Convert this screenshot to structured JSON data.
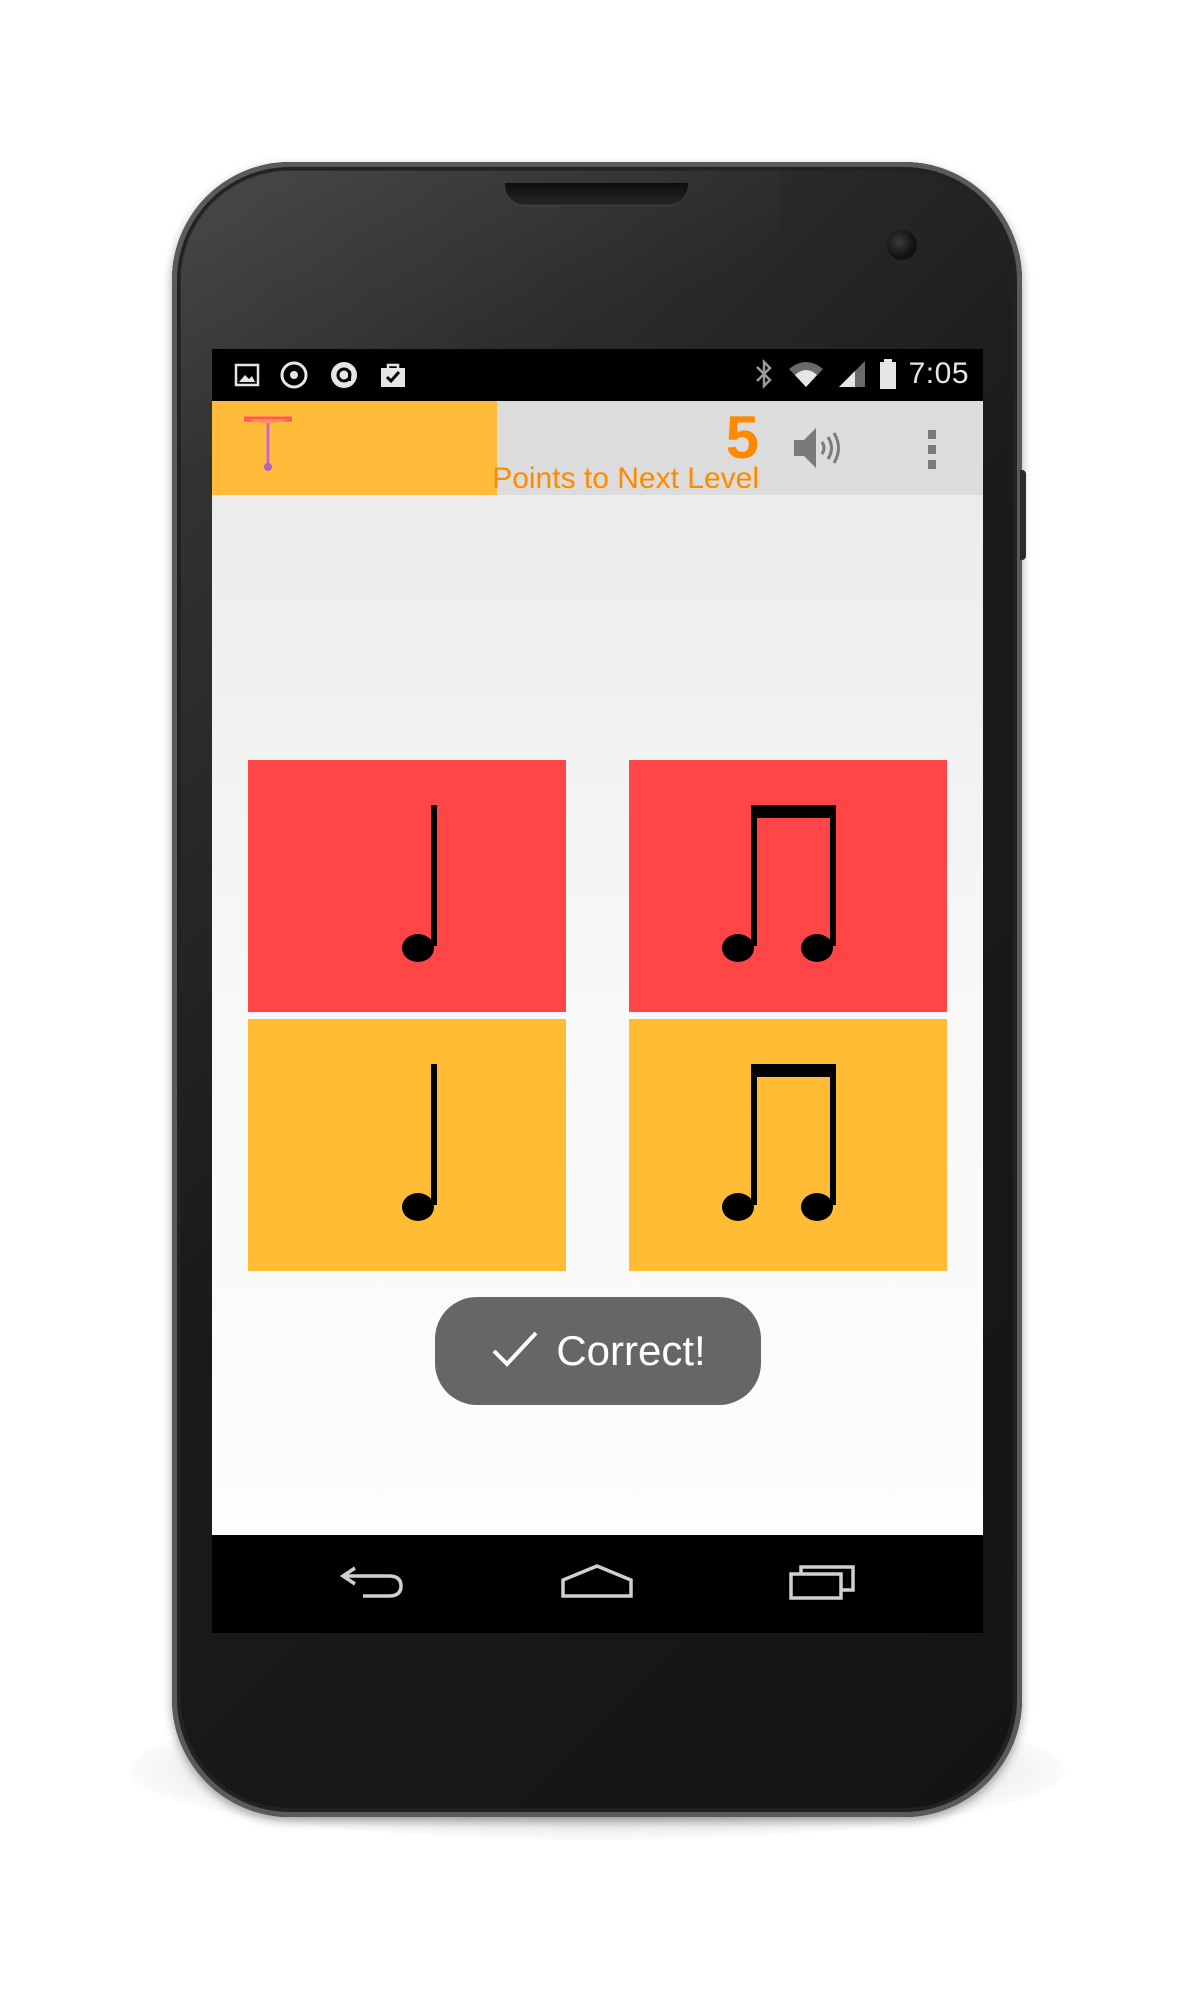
{
  "status_bar": {
    "time": "7:05",
    "left_icons": [
      "gallery-icon",
      "sync-icon",
      "at-icon",
      "store-icon"
    ],
    "right_icons": [
      "bluetooth-icon",
      "wifi-icon",
      "signal-icon",
      "battery-icon"
    ]
  },
  "action_bar": {
    "score": "5",
    "points_label": "Points to Next Level",
    "progress_fraction": 0.37,
    "colors": {
      "progress": "#ffbc3a",
      "track": "#dcdcdc",
      "accent": "#ff8a00"
    },
    "icons": [
      "app-logo-icon",
      "speaker-icon",
      "overflow-menu-icon"
    ]
  },
  "tiles": [
    {
      "rhythm": "quarter-note",
      "color": "#ff4545",
      "row": "top"
    },
    {
      "rhythm": "two-eighth-notes",
      "color": "#ff4545",
      "row": "top"
    },
    {
      "rhythm": "quarter-note",
      "color": "#ffbc34",
      "row": "bottom"
    },
    {
      "rhythm": "two-eighth-notes",
      "color": "#ffbc34",
      "row": "bottom"
    }
  ],
  "toast": {
    "icon": "checkmark-icon",
    "text": "Correct!"
  },
  "nav_bar": {
    "icons": [
      "back-icon",
      "home-icon",
      "recents-icon"
    ]
  }
}
